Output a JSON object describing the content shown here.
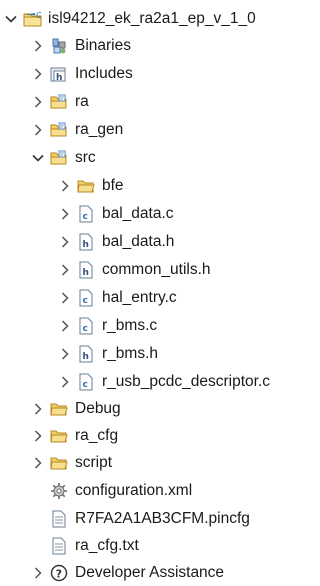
{
  "project": {
    "label": "isl94212_ek_ra2a1_ep_v_1_0",
    "icon": "c-project-icon",
    "expanded": true,
    "children": [
      {
        "label": "Binaries",
        "icon": "binaries-icon",
        "expanded": false
      },
      {
        "label": "Includes",
        "icon": "includes-icon",
        "expanded": false
      },
      {
        "label": "ra",
        "icon": "source-folder-icon",
        "expanded": false
      },
      {
        "label": "ra_gen",
        "icon": "source-folder-icon",
        "expanded": false
      },
      {
        "label": "src",
        "icon": "source-folder-icon",
        "expanded": true,
        "children": [
          {
            "label": "bfe",
            "icon": "folder-icon",
            "expanded": false
          },
          {
            "label": "bal_data.c",
            "icon": "c-file-icon",
            "expanded": false
          },
          {
            "label": "bal_data.h",
            "icon": "h-file-icon",
            "expanded": false
          },
          {
            "label": "common_utils.h",
            "icon": "h-file-icon",
            "expanded": false
          },
          {
            "label": "hal_entry.c",
            "icon": "c-file-icon",
            "expanded": false
          },
          {
            "label": "r_bms.c",
            "icon": "c-file-icon",
            "expanded": false
          },
          {
            "label": "r_bms.h",
            "icon": "h-file-icon",
            "expanded": false
          },
          {
            "label": "r_usb_pcdc_descriptor.c",
            "icon": "c-file-icon",
            "expanded": false
          }
        ]
      },
      {
        "label": "Debug",
        "icon": "folder-icon",
        "expanded": false
      },
      {
        "label": "ra_cfg",
        "icon": "folder-icon",
        "expanded": false
      },
      {
        "label": "script",
        "icon": "folder-icon",
        "expanded": false
      },
      {
        "label": "configuration.xml",
        "icon": "gear-file-icon"
      },
      {
        "label": "R7FA2A1AB3CFM.pincfg",
        "icon": "text-file-icon"
      },
      {
        "label": "ra_cfg.txt",
        "icon": "text-file-icon"
      },
      {
        "label": "Developer Assistance",
        "icon": "help-icon",
        "expanded": false
      }
    ]
  }
}
